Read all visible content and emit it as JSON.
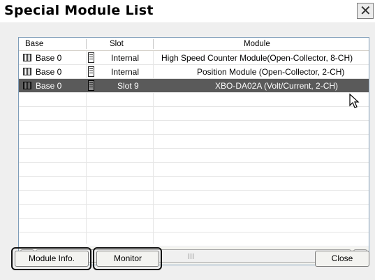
{
  "window": {
    "title": "Special Module List",
    "close_glyph": "✕"
  },
  "list": {
    "columns": [
      "Base",
      "Slot",
      "Module"
    ],
    "rows": [
      {
        "base": "Base 0",
        "slot": "Internal",
        "module": "High Speed Counter Module(Open-Collector, 8-CH)",
        "selected": false
      },
      {
        "base": "Base 0",
        "slot": "Internal",
        "module": "Position Module (Open-Collector, 2-CH)",
        "selected": false
      },
      {
        "base": "Base 0",
        "slot": "Slot 9",
        "module": "XBO-DA02A (Volt/Current, 2-CH)",
        "selected": true
      }
    ],
    "scroll_left_glyph": "<",
    "scroll_right_glyph": ">",
    "selection_color": "#5a5a5a"
  },
  "buttons": {
    "module_info": "Module Info.",
    "monitor": "Monitor",
    "close": "Close"
  },
  "icons": {
    "base": "rack-icon",
    "slot": "module-card-icon",
    "cursor": "mouse-pointer-icon"
  }
}
